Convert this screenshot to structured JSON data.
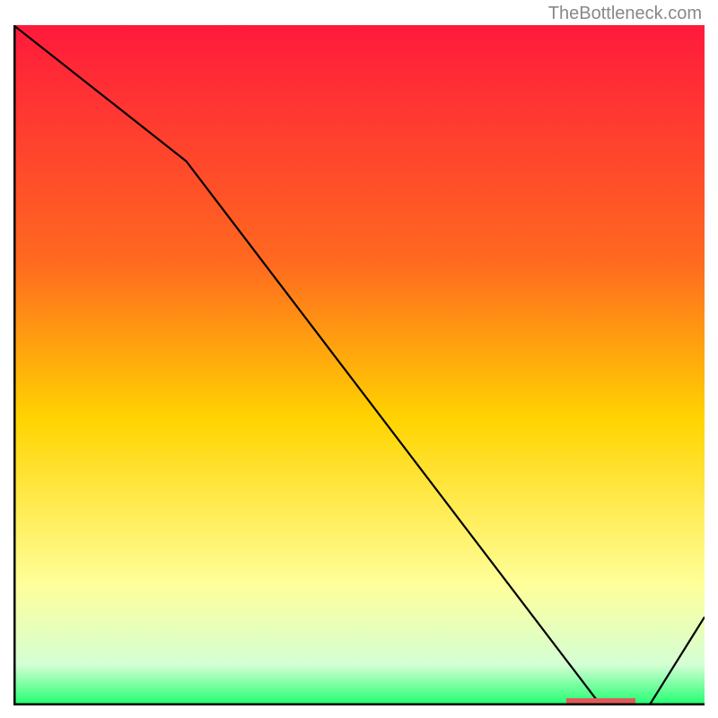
{
  "watermark": "TheBottleneck.com",
  "chart_data": {
    "type": "line",
    "title": "",
    "xlabel": "",
    "ylabel": "",
    "xlim": [
      0,
      100
    ],
    "ylim": [
      0,
      100
    ],
    "x": [
      0,
      25,
      85,
      92,
      100
    ],
    "values": [
      100,
      80,
      0,
      0,
      13
    ],
    "marker_region_x": [
      80,
      90
    ],
    "background_gradient": {
      "top": "#ff1a3c",
      "mid1": "#ff6a1f",
      "mid2": "#ffd400",
      "mid3": "#ffff99",
      "mid4": "#d4ffd4",
      "bottom": "#1eff6e"
    },
    "axes_color": "#000000",
    "line_color": "#000000",
    "marker_color": "#e05a5a"
  }
}
